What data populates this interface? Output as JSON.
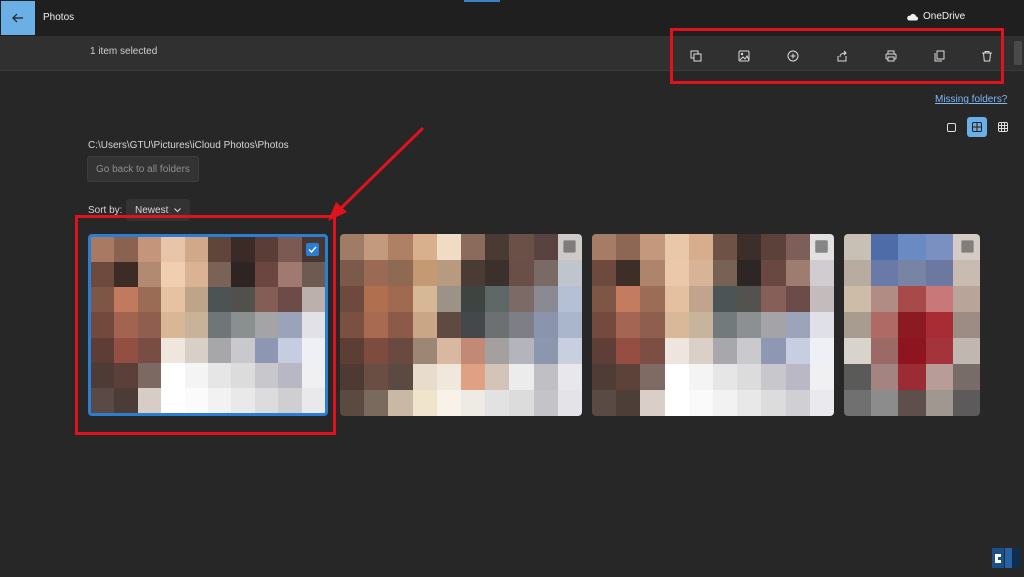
{
  "app": {
    "title": "Photos",
    "cloud": "OneDrive"
  },
  "commandbar": {
    "selection_text": "1 item selected"
  },
  "toolbar_icons": [
    "copy-image-icon",
    "edit-image-icon",
    "add-icon",
    "share-icon",
    "print-icon",
    "duplicate-icon",
    "delete-icon"
  ],
  "missing_folders": "Missing folders?",
  "view_modes": [
    "single-view",
    "medium-grid",
    "small-grid"
  ],
  "active_view": "medium-grid",
  "folder": {
    "path": "C:\\Users\\GTU\\Pictures\\iCloud Photos\\Photos",
    "go_back_label": "Go back to all folders"
  },
  "sort": {
    "label": "Sort by:",
    "value": "Newest"
  },
  "photos": [
    {
      "selected": true
    },
    {
      "selected": false
    },
    {
      "selected": false
    },
    {
      "selected": false
    }
  ],
  "colors": {
    "accent": "#2a7fd4",
    "highlight_red": "#e0121b",
    "background": "#272727"
  }
}
